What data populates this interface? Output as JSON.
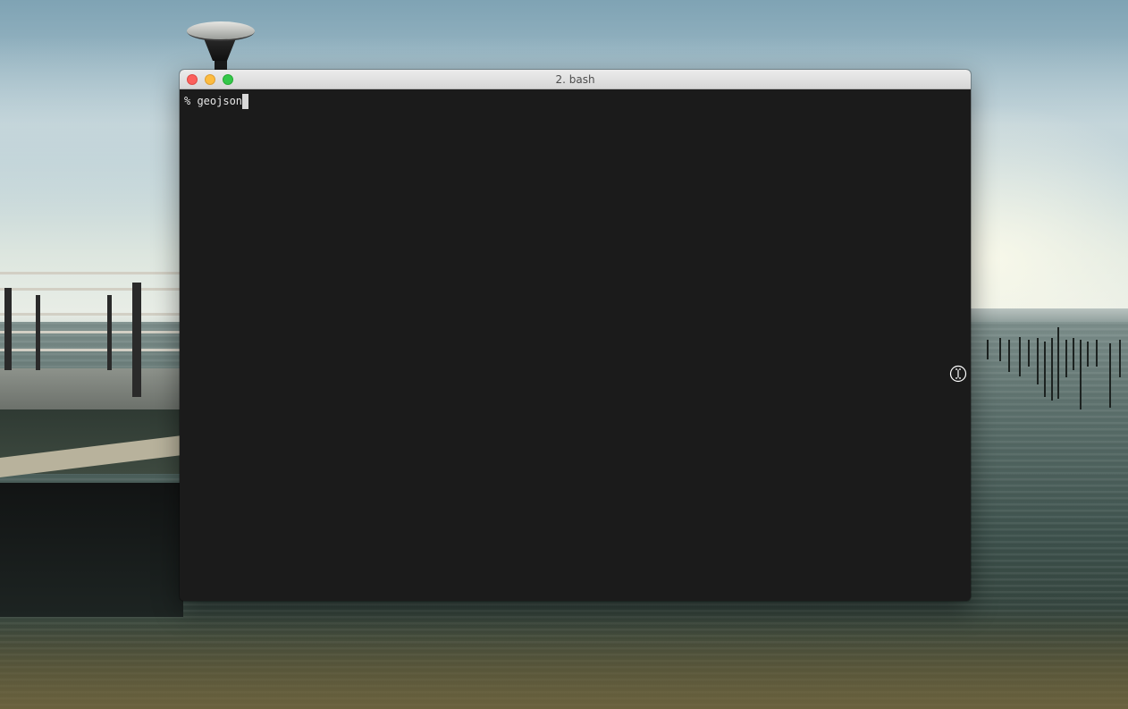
{
  "window": {
    "title": "2. bash"
  },
  "terminal": {
    "prompt": "% ",
    "command": "geojson"
  },
  "icons": {
    "close": "close-button-icon",
    "minimize": "minimize-button-icon",
    "zoom": "zoom-button-icon",
    "pointer": "ibeam-cursor-icon"
  },
  "colors": {
    "terminal_background": "#1b1b1b",
    "terminal_text": "#e6e6e6",
    "close": "#fc605c",
    "minimize": "#fdbc40",
    "zoom": "#34c84a"
  }
}
